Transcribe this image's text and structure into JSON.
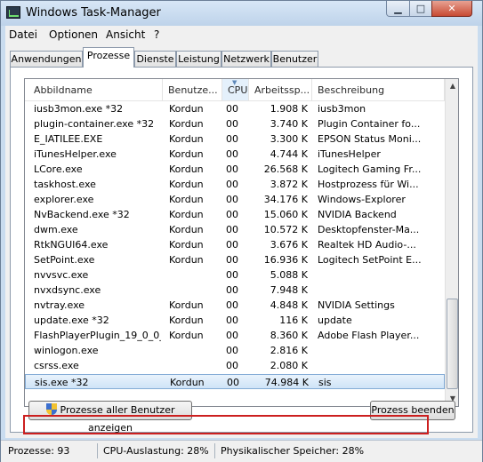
{
  "window": {
    "title": "Windows Task-Manager"
  },
  "menu": [
    "Datei",
    "Optionen",
    "Ansicht",
    "?"
  ],
  "tabs": [
    "Anwendungen",
    "Prozesse",
    "Dienste",
    "Leistung",
    "Netzwerk",
    "Benutzer"
  ],
  "columns": [
    "Abbildname",
    "Benutze...",
    "CPU",
    "Arbeitssp...",
    "Beschreibung"
  ],
  "rows": [
    [
      "iusb3mon.exe *32",
      "Kordun",
      "00",
      "1.908 K",
      "iusb3mon"
    ],
    [
      "plugin-container.exe *32",
      "Kordun",
      "00",
      "3.740 K",
      "Plugin Container fo..."
    ],
    [
      "E_IATILEE.EXE",
      "Kordun",
      "00",
      "3.300 K",
      "EPSON Status Moni..."
    ],
    [
      "iTunesHelper.exe",
      "Kordun",
      "00",
      "4.744 K",
      "iTunesHelper"
    ],
    [
      "LCore.exe",
      "Kordun",
      "00",
      "26.568 K",
      "Logitech Gaming Fr..."
    ],
    [
      "taskhost.exe",
      "Kordun",
      "00",
      "3.872 K",
      "Hostprozess für Wi..."
    ],
    [
      "explorer.exe",
      "Kordun",
      "00",
      "34.176 K",
      "Windows-Explorer"
    ],
    [
      "NvBackend.exe *32",
      "Kordun",
      "00",
      "15.060 K",
      "NVIDIA Backend"
    ],
    [
      "dwm.exe",
      "Kordun",
      "00",
      "10.572 K",
      "Desktopfenster-Ma..."
    ],
    [
      "RtkNGUI64.exe",
      "Kordun",
      "00",
      "3.676 K",
      "Realtek HD Audio-..."
    ],
    [
      "SetPoint.exe",
      "Kordun",
      "00",
      "16.936 K",
      "Logitech SetPoint E..."
    ],
    [
      "nvvsvc.exe",
      "",
      "00",
      "5.088 K",
      ""
    ],
    [
      "nvxdsync.exe",
      "",
      "00",
      "7.948 K",
      ""
    ],
    [
      "nvtray.exe",
      "Kordun",
      "00",
      "4.848 K",
      "NVIDIA Settings"
    ],
    [
      "update.exe *32",
      "Kordun",
      "00",
      "116 K",
      "update"
    ],
    [
      "FlashPlayerPlugin_19_0_0_...",
      "Kordun",
      "00",
      "8.360 K",
      "Adobe Flash Player..."
    ],
    [
      "winlogon.exe",
      "",
      "00",
      "2.816 K",
      ""
    ],
    [
      "csrss.exe",
      "",
      "00",
      "2.080 K",
      ""
    ],
    [
      "sis.exe *32",
      "Kordun",
      "00",
      "74.984 K",
      "sis"
    ]
  ],
  "buttons": {
    "show_all": "Prozesse aller Benutzer anzeigen",
    "end_process": "Prozess beenden"
  },
  "status": {
    "processes": "Prozesse: 93",
    "cpu": "CPU-Auslastung: 28%",
    "memory": "Physikalischer Speicher: 28%"
  }
}
